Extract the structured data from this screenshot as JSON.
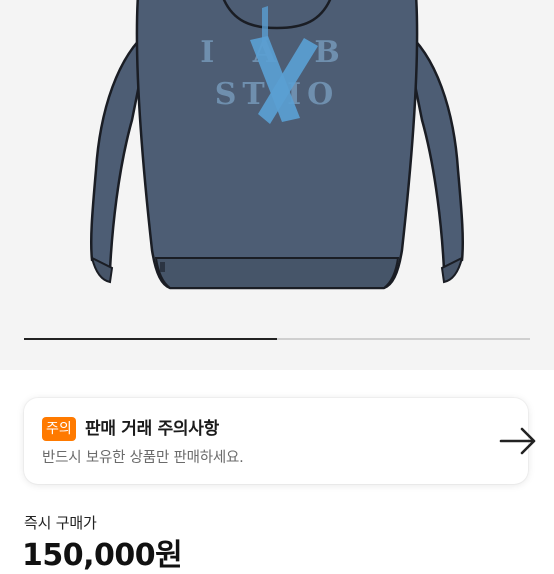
{
  "product": {
    "image_print_top": "I A B",
    "image_print_bottom": "ST  IO",
    "image_print_accent": "X",
    "hoodie_color": "#4d5d74",
    "print_color": "#6f8fae",
    "accent_color": "#5a9fd2"
  },
  "gallery": {
    "progress": 0.5
  },
  "notice": {
    "badge": "주의",
    "title": "판매 거래 주의사항",
    "description": "반드시 보유한 상품만 판매하세요.",
    "arrow_icon": "arrow-right-icon",
    "badge_color": "#ff7a00"
  },
  "purchase": {
    "label": "즉시 구매가",
    "price": "150,000원"
  }
}
